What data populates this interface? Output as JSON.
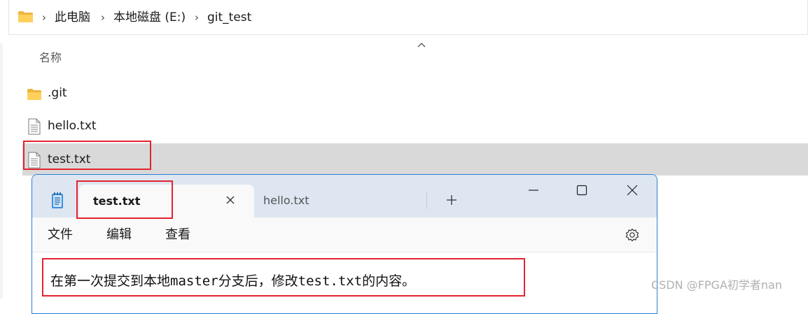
{
  "address_bar": {
    "icon": "folder-icon",
    "breadcrumbs": [
      "此电脑",
      "本地磁盘 (E:)",
      "git_test"
    ]
  },
  "file_list": {
    "column_header": "名称",
    "items": [
      {
        "name": ".git",
        "icon": "folder-icon"
      },
      {
        "name": "hello.txt",
        "icon": "text-file-icon"
      },
      {
        "name": "test.txt",
        "icon": "text-file-icon",
        "selected": true
      }
    ]
  },
  "notepad": {
    "app_icon": "notepad-icon",
    "tabs": [
      {
        "label": "test.txt",
        "active": true
      },
      {
        "label": "hello.txt",
        "active": false
      }
    ],
    "menu": [
      "文件",
      "编辑",
      "查看"
    ],
    "content": "在第一次提交到本地master分支后，修改test.txt的内容。"
  },
  "watermark": "CSDN @FPGA初学者nan",
  "colors": {
    "highlight_box": "#e4232f",
    "selected_row": "#d9d9d9",
    "notepad_titlebar": "#dde6f1",
    "window_border": "#2b7fd6"
  }
}
